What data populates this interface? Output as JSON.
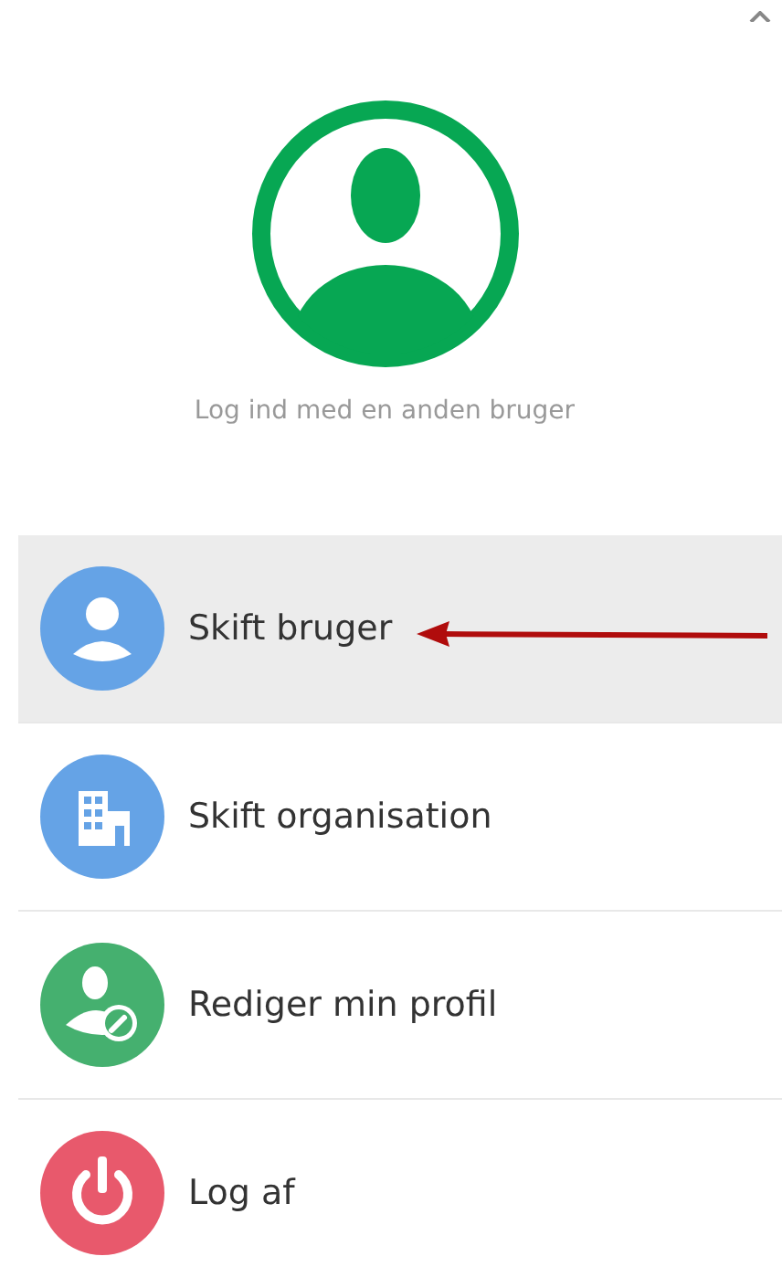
{
  "header": {
    "caption": "Log ind med en anden bruger"
  },
  "menu": [
    {
      "kind": "user",
      "label": "Skift bruger",
      "color": "#65a3e6",
      "selected": true
    },
    {
      "kind": "organisation",
      "label": "Skift organisation",
      "color": "#65a3e6",
      "selected": false
    },
    {
      "kind": "edit-profile",
      "label": "Rediger min profil",
      "color": "#45b06f",
      "selected": false
    },
    {
      "kind": "power",
      "label": "Log af",
      "color": "#e8596c",
      "selected": false
    }
  ]
}
